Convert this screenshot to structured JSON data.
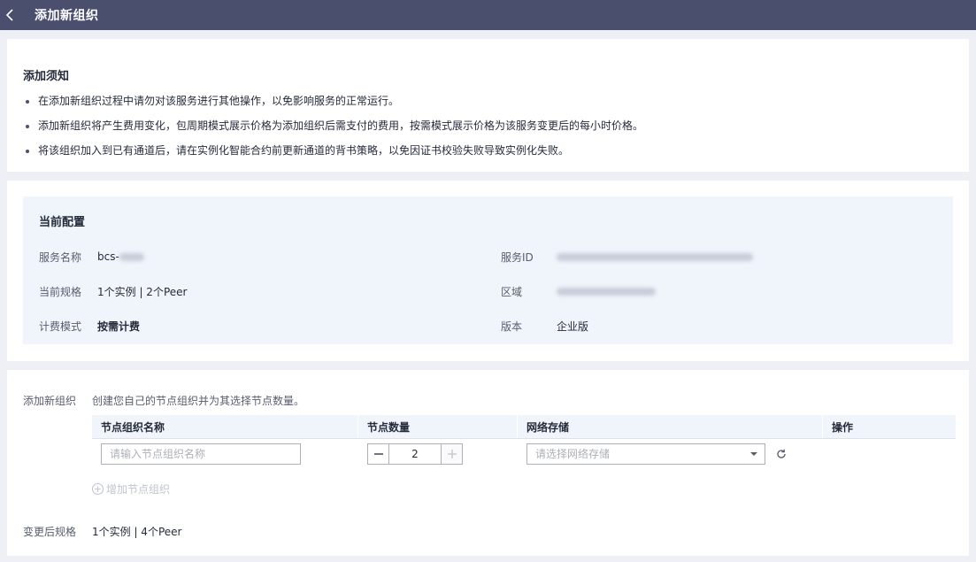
{
  "header": {
    "title": "添加新组织"
  },
  "notice": {
    "title": "添加须知",
    "items": [
      "在添加新组织过程中请勿对该服务进行其他操作，以免影响服务的正常运行。",
      "添加新组织将产生费用变化，包周期模式展示价格为添加组织后需支付的费用，按需模式展示价格为该服务变更后的每小时价格。",
      "将该组织加入到已有通道后，请在实例化智能合约前更新通道的背书策略，以免因证书校验失败导致实例化失败。"
    ]
  },
  "config": {
    "title": "当前配置",
    "service_name_label": "服务名称",
    "service_name_value": "bcs-",
    "spec_label": "当前规格",
    "spec_value": "1个实例 | 2个Peer",
    "billing_label": "计费模式",
    "billing_value": "按需计费",
    "service_id_label": "服务ID",
    "region_label": "区域",
    "version_label": "版本",
    "version_value": "企业版"
  },
  "add_org": {
    "label": "添加新组织",
    "description": "创建您自己的节点组织并为其选择节点数量。",
    "columns": [
      "节点组织名称",
      "节点数量",
      "网络存储",
      "操作"
    ],
    "row": {
      "name_placeholder": "请输入节点组织名称",
      "quantity": "2",
      "storage_placeholder": "请选择网络存储"
    },
    "add_group_label": "增加节点组织",
    "after_spec_label": "变更后规格",
    "after_spec_value": "1个实例 | 4个Peer"
  },
  "icons": [
    "back-icon",
    "minus-icon",
    "plus-icon",
    "chevron-down-icon",
    "refresh-icon",
    "plus-circle-icon"
  ]
}
